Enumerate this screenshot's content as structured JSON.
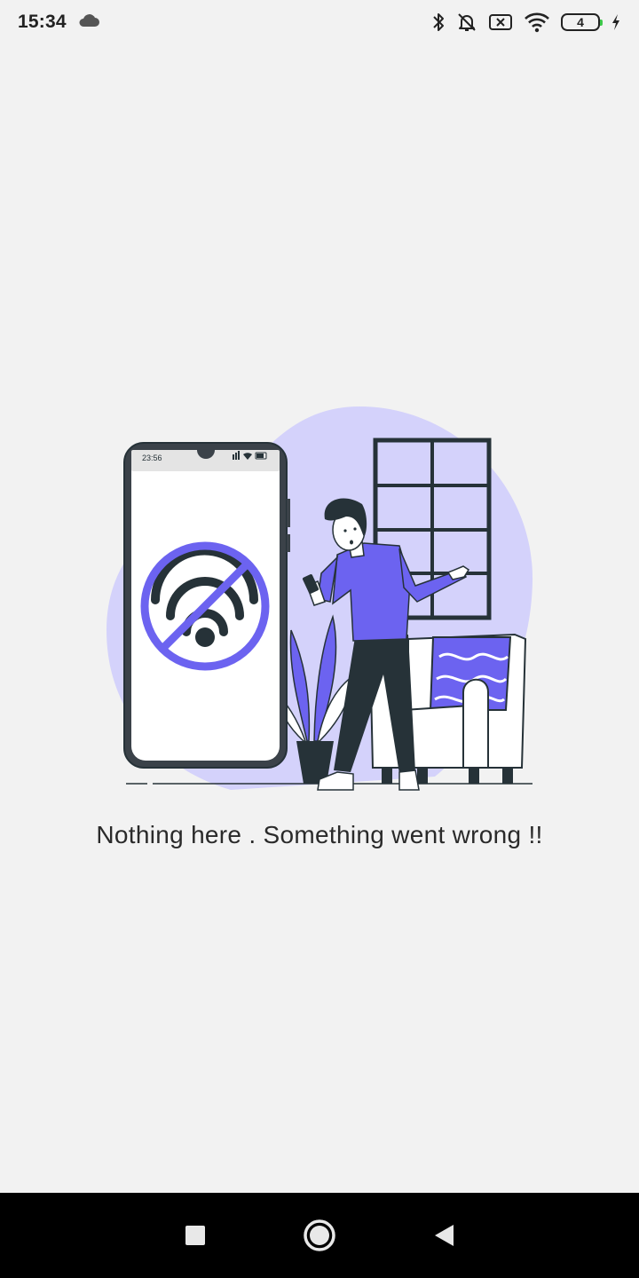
{
  "status_bar": {
    "time": "15:34",
    "battery_level": "4",
    "icons": [
      "cloud-icon",
      "bluetooth-icon",
      "bell-off-icon",
      "sim-off-icon",
      "wifi-icon",
      "battery-icon",
      "charging-icon"
    ]
  },
  "illustration": {
    "phone_time": "23:56",
    "accent_color": "#6c63f0",
    "blob_color": "#d4d2fb",
    "ink_color": "#263238"
  },
  "message": {
    "text": "Nothing here . Something went wrong !!"
  },
  "nav_bar": {
    "icons": [
      "recents-square-icon",
      "home-circle-icon",
      "back-triangle-icon"
    ]
  }
}
